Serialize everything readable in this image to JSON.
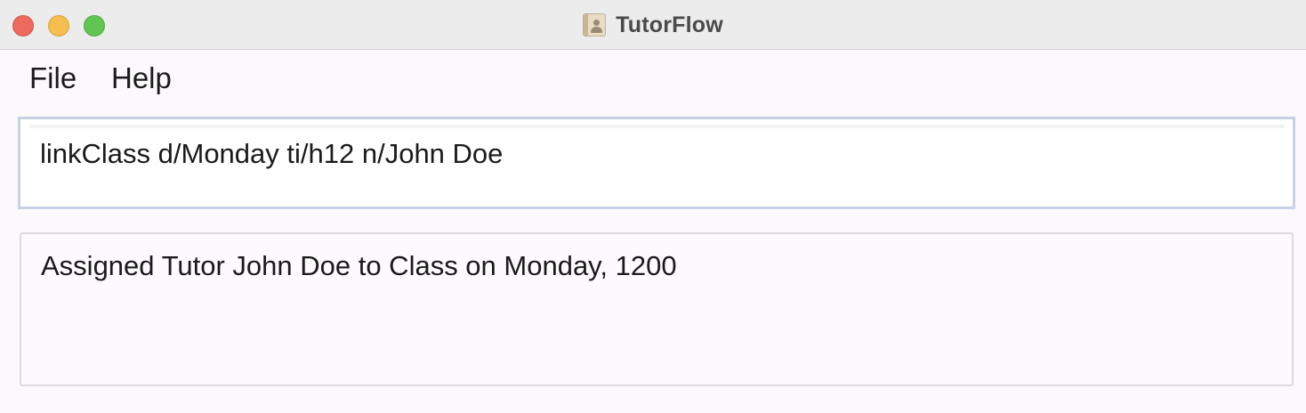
{
  "window": {
    "title": "TutorFlow",
    "app_icon": "address-book-icon",
    "controls": [
      "close",
      "minimize",
      "maximize"
    ]
  },
  "menubar": {
    "file_label": "File",
    "help_label": "Help"
  },
  "command": {
    "value": "linkClass d/Monday ti/h12 n/John Doe"
  },
  "result": {
    "text": "Assigned Tutor John Doe to Class on Monday, 1200"
  },
  "colors": {
    "close": "#ec6a5e",
    "minimize": "#f4bf4f",
    "maximize": "#61c554",
    "command_border": "#c9d0e6"
  }
}
